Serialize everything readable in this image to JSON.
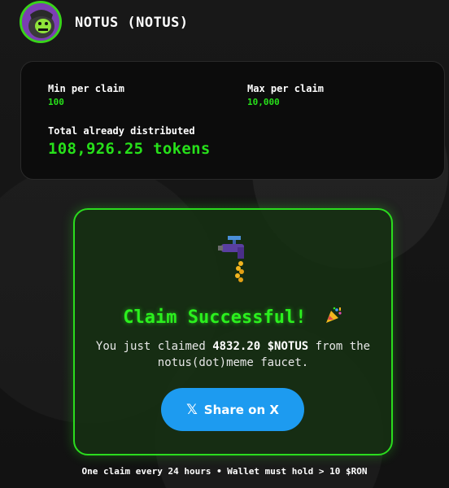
{
  "header": {
    "title": "NOTUS (NOTUS)"
  },
  "stats": {
    "min_label": "Min per claim",
    "min_value": "100",
    "max_label": "Max per claim",
    "max_value": "10,000",
    "total_label": "Total already distributed",
    "total_value": "108,926.25 tokens"
  },
  "card": {
    "success_title": "Claim Successful!",
    "msg_prefix": "You just claimed ",
    "amount": "4832.20 $NOTUS",
    "msg_suffix": " from the notus(dot)meme faucet.",
    "share_label": "Share on X"
  },
  "footer": {
    "text": "One claim every 24 hours • Wallet must hold > 10 $RON"
  },
  "colors": {
    "accent_green": "#27e01a",
    "share_blue": "#1d9bf0",
    "avatar_ring": "#39d31b"
  },
  "icons": {
    "avatar": "gorilla-avatar-icon",
    "faucet": "faucet-icon",
    "party": "party-popper-icon",
    "share": "x-logo-icon"
  }
}
